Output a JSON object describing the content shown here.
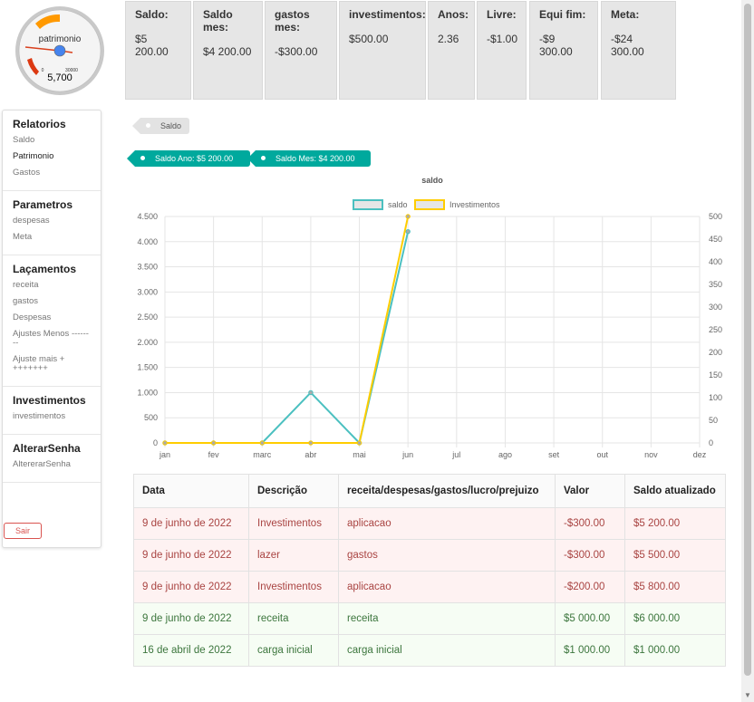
{
  "gauge": {
    "label": "patrimonio",
    "value": "5,700",
    "min": "0",
    "max": "30000"
  },
  "stats": [
    {
      "label": "Saldo:",
      "value": "$5 200.00"
    },
    {
      "label": "Saldo mes:",
      "value": "$4 200.00"
    },
    {
      "label": "gastos mes:",
      "value": "-$300.00"
    },
    {
      "label": "investimentos:",
      "value": "$500.00"
    },
    {
      "label": "Anos:",
      "value": "2.36"
    },
    {
      "label": "Livre:",
      "value": "-$1.00"
    },
    {
      "label": "Equi fim:",
      "value": "-$9 300.00"
    },
    {
      "label": "Meta:",
      "value": "-$24 300.00"
    }
  ],
  "sidebar": {
    "groups": [
      {
        "title": "Relatorios",
        "items": [
          "Saldo",
          "Patrimonio",
          "Gastos"
        ]
      },
      {
        "title": "Parametros",
        "items": [
          "despesas",
          "Meta"
        ]
      },
      {
        "title": "Laçamentos",
        "items": [
          "receita",
          "gastos",
          "Despesas",
          "Ajustes Menos --------",
          "Ajuste mais ++++++++"
        ]
      },
      {
        "title": "Investimentos",
        "items": [
          "investimentos"
        ]
      },
      {
        "title": "AlterarSenha",
        "items": [
          "AltererarSenha"
        ]
      }
    ],
    "logout": "Sair"
  },
  "tags": {
    "saldo": "Saldo",
    "saldo_ano": "Saldo Ano: $5 200.00",
    "saldo_mes": "Saldo Mes: $4 200.00"
  },
  "colors": {
    "saldo": "#4bc0c0",
    "investimentos": "#ffcd00"
  },
  "chart_data": {
    "type": "line",
    "title": "saldo",
    "categories": [
      "jan",
      "fev",
      "marc",
      "abr",
      "mai",
      "jun",
      "jul",
      "ago",
      "set",
      "out",
      "nov",
      "dez"
    ],
    "series": [
      {
        "name": "saldo",
        "axis": "left",
        "values": [
          0,
          0,
          0,
          1000,
          0,
          4200,
          null,
          null,
          null,
          null,
          null,
          null
        ]
      },
      {
        "name": "Investimentos",
        "axis": "right",
        "values": [
          0,
          0,
          0,
          0,
          0,
          500,
          null,
          null,
          null,
          null,
          null,
          null
        ]
      }
    ],
    "y_left": {
      "min": 0,
      "max": 4500,
      "ticks": [
        "0",
        "500",
        "1.000",
        "1.500",
        "2.000",
        "2.500",
        "3.000",
        "3.500",
        "4.000",
        "4.500"
      ]
    },
    "y_right": {
      "min": 0,
      "max": 500,
      "ticks": [
        "0",
        "50",
        "100",
        "150",
        "200",
        "250",
        "300",
        "350",
        "400",
        "450",
        "500"
      ]
    },
    "grid": true,
    "legend": "top"
  },
  "table": {
    "headers": [
      "Data",
      "Descrição",
      "receita/despesas/gastos/lucro/prejuizo",
      "Valor",
      "Saldo atualizado"
    ],
    "rows": [
      {
        "type": "red",
        "cells": [
          "9 de junho de 2022",
          "Investimentos",
          "aplicacao",
          "-$300.00",
          "$5 200.00"
        ]
      },
      {
        "type": "red",
        "cells": [
          "9 de junho de 2022",
          "lazer",
          "gastos",
          "-$300.00",
          "$5 500.00"
        ]
      },
      {
        "type": "red",
        "cells": [
          "9 de junho de 2022",
          "Investimentos",
          "aplicacao",
          "-$200.00",
          "$5 800.00"
        ]
      },
      {
        "type": "green",
        "cells": [
          "9 de junho de 2022",
          "receita",
          "receita",
          "$5 000.00",
          "$6 000.00"
        ]
      },
      {
        "type": "green",
        "cells": [
          "16 de abril de 2022",
          "carga inicial",
          "carga inicial",
          "$1 000.00",
          "$1 000.00"
        ]
      }
    ]
  }
}
